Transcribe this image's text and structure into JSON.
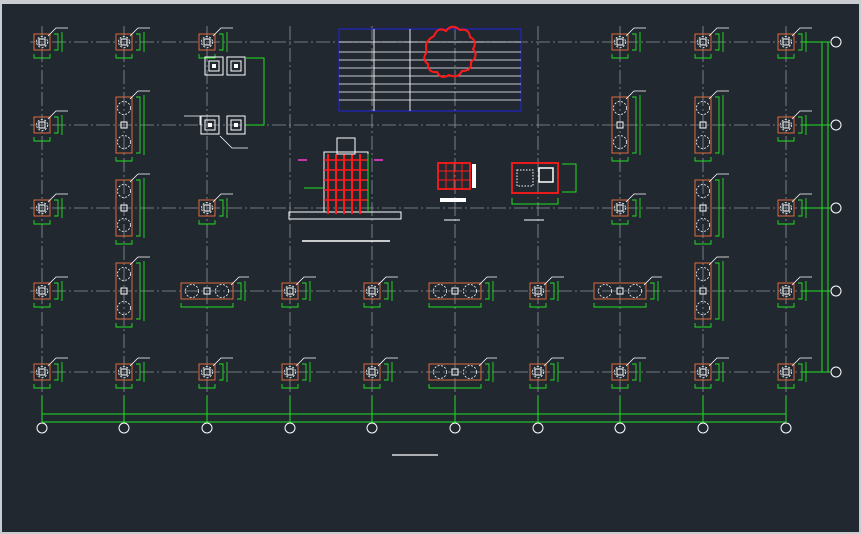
{
  "drawing": {
    "view": "foundation-plan",
    "background_color": "#212830",
    "colors": {
      "grid_axis": "#8c949c",
      "dimension": "#22e022",
      "outline": "#ffffff",
      "pile_cap": "#e06a3c",
      "rebar": "#ff1a1a",
      "table_border": "#2424c8",
      "revision_cloud": "#ff1a1a",
      "leader_marker": "#ff3bd6"
    },
    "grid": {
      "column_axis_count": 10,
      "row_axis_count": 5
    },
    "foundation_types": [
      "single-pile",
      "double-pile-vertical",
      "double-pile-horizontal",
      "four-pile"
    ],
    "detail_views": [
      "column-section",
      "plan-detail-a",
      "plan-detail-b"
    ],
    "title_blocks": [
      "plan-title-underline",
      "detail-title-underline"
    ]
  }
}
